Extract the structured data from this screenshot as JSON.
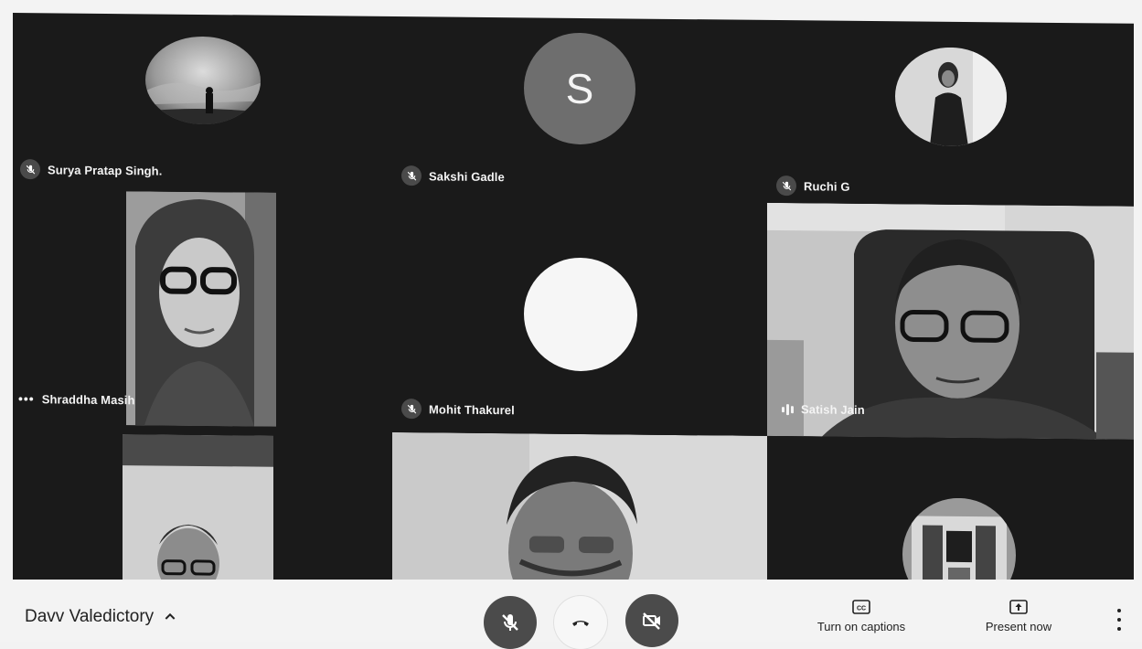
{
  "participants": {
    "surya": {
      "name": "Surya Pratap Singh."
    },
    "sakshi": {
      "name": "Sakshi Gadle",
      "initial": "S"
    },
    "ruchi": {
      "name": "Ruchi G"
    },
    "shraddha": {
      "name": "Shraddha Masih"
    },
    "mohit": {
      "name": "Mohit Thakurel"
    },
    "satish": {
      "name": "Satish Jain"
    }
  },
  "toolbar": {
    "meeting_title": "Davv Valedictory",
    "captions_label": "Turn on captions",
    "present_label": "Present now"
  },
  "colors": {
    "stage_background": "#1a1a1a",
    "button_dark": "#4b4b4b",
    "avatar_grey": "#6e6e6e"
  }
}
